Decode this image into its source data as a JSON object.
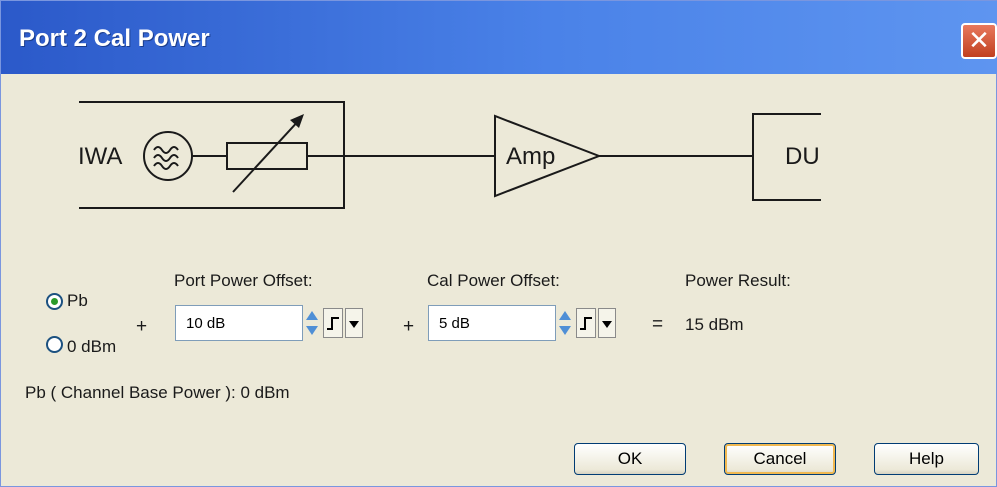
{
  "window": {
    "title": "Port 2 Cal Power",
    "close_glyph": "✕"
  },
  "diagram": {
    "source_label": "IWA",
    "amp_label": "Amp",
    "dut_label": "DU"
  },
  "power_base": {
    "options": [
      {
        "label": "Pb",
        "checked": true
      },
      {
        "label": "0 dBm",
        "checked": false
      }
    ]
  },
  "operators": {
    "plus1": "+",
    "plus2": "+",
    "equals": "="
  },
  "port_power_offset": {
    "label": "Port Power Offset:",
    "value": "10 dB"
  },
  "cal_power_offset": {
    "label": "Cal Power Offset:",
    "value": "5 dB"
  },
  "power_result": {
    "label": "Power Result:",
    "value": "15 dBm"
  },
  "info": {
    "channel_base_power": "Pb ( Channel Base Power ): 0 dBm"
  },
  "buttons": {
    "ok": "OK",
    "cancel": "Cancel",
    "help": "Help"
  }
}
